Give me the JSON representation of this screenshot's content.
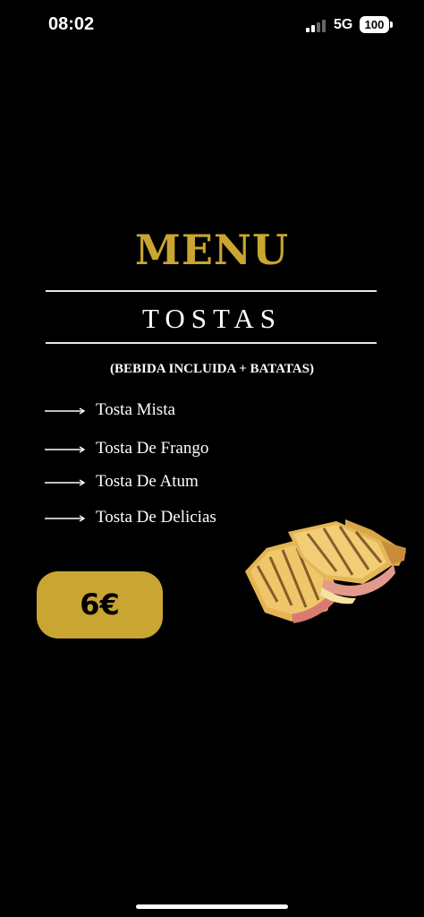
{
  "status_bar": {
    "time": "08:02",
    "network": "5G",
    "battery": "100"
  },
  "menu": {
    "title": "MENU",
    "section": "TOSTAS",
    "subtitle": "(BEBIDA  INCLUIDA + BATATAS)",
    "items": [
      {
        "label": "Tosta Mista"
      },
      {
        "label": "Tosta De Frango"
      },
      {
        "label": "Tosta De Atum"
      },
      {
        "label": "Tosta De Delicias"
      }
    ],
    "price": "6€"
  },
  "colors": {
    "accent_gold": "#c9a531",
    "background": "#000000"
  },
  "icons": {
    "bullet": "arrow-right-icon",
    "image": "toasted-sandwich-image"
  }
}
